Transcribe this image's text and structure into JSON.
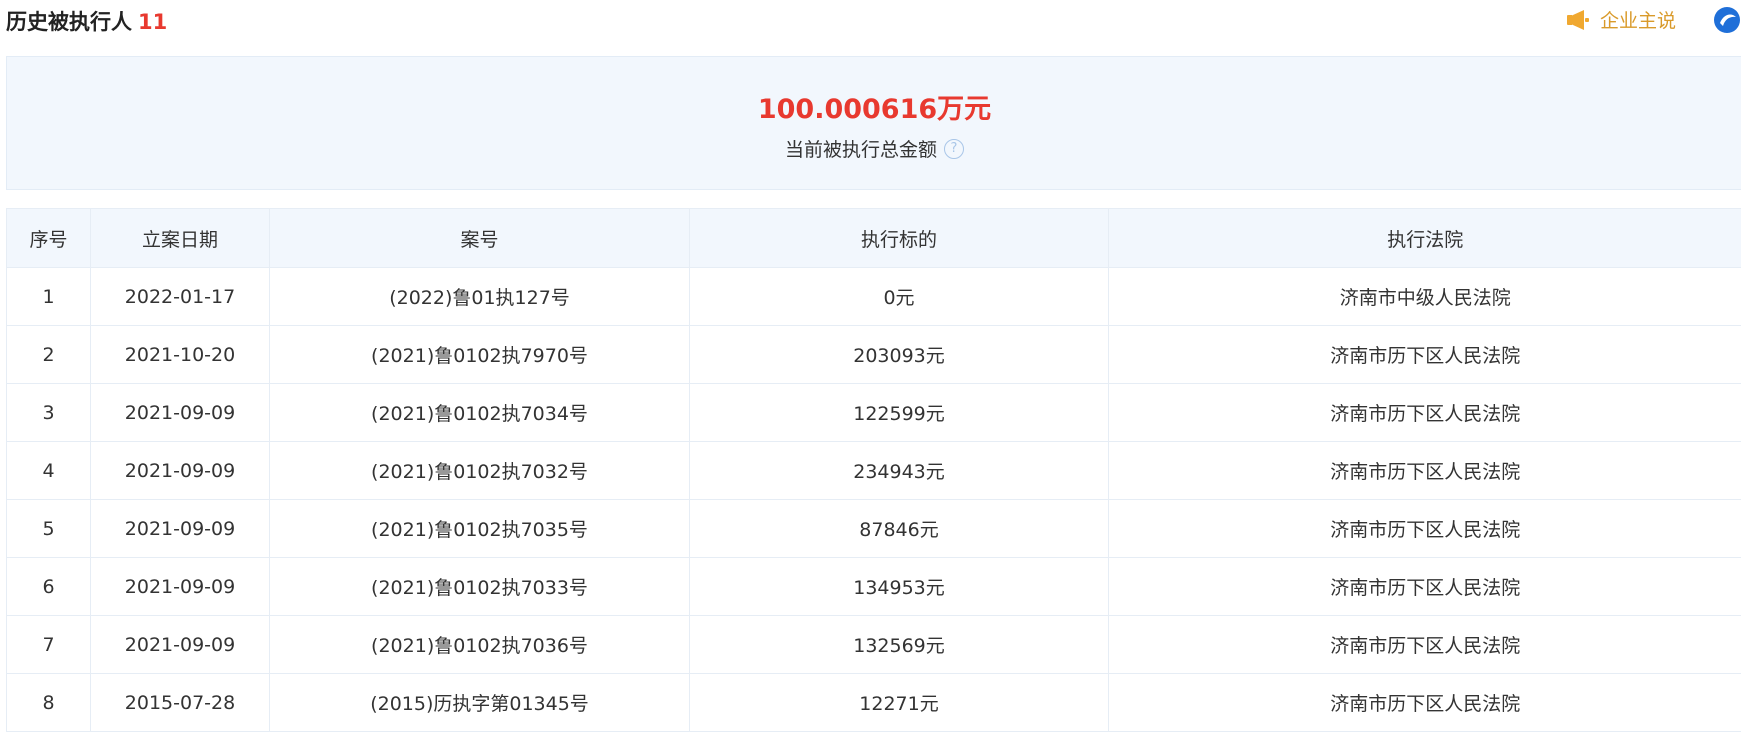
{
  "header": {
    "title": "历史被执行人",
    "count": "11",
    "speak_label": "企业主说"
  },
  "summary": {
    "amount": "100.000616万元",
    "label": "当前被执行总金额",
    "help_icon": "question-circle-icon"
  },
  "table": {
    "columns": [
      "序号",
      "立案日期",
      "案号",
      "执行标的",
      "执行法院"
    ],
    "rows": [
      [
        "1",
        "2022-01-17",
        "(2022)鲁01执127号",
        "0元",
        "济南市中级人民法院"
      ],
      [
        "2",
        "2021-10-20",
        "(2021)鲁0102执7970号",
        "203093元",
        "济南市历下区人民法院"
      ],
      [
        "3",
        "2021-09-09",
        "(2021)鲁0102执7034号",
        "122599元",
        "济南市历下区人民法院"
      ],
      [
        "4",
        "2021-09-09",
        "(2021)鲁0102执7032号",
        "234943元",
        "济南市历下区人民法院"
      ],
      [
        "5",
        "2021-09-09",
        "(2021)鲁0102执7035号",
        "87846元",
        "济南市历下区人民法院"
      ],
      [
        "6",
        "2021-09-09",
        "(2021)鲁0102执7033号",
        "134953元",
        "济南市历下区人民法院"
      ],
      [
        "7",
        "2021-09-09",
        "(2021)鲁0102执7036号",
        "132569元",
        "济南市历下区人民法院"
      ],
      [
        "8",
        "2015-07-28",
        "(2015)历执字第01345号",
        "12271元",
        "济南市历下区人民法院"
      ]
    ]
  },
  "colors": {
    "accent_red": "#e8392f",
    "speak_gold": "#d99a2a",
    "panel_bg": "#f2f7fd"
  }
}
